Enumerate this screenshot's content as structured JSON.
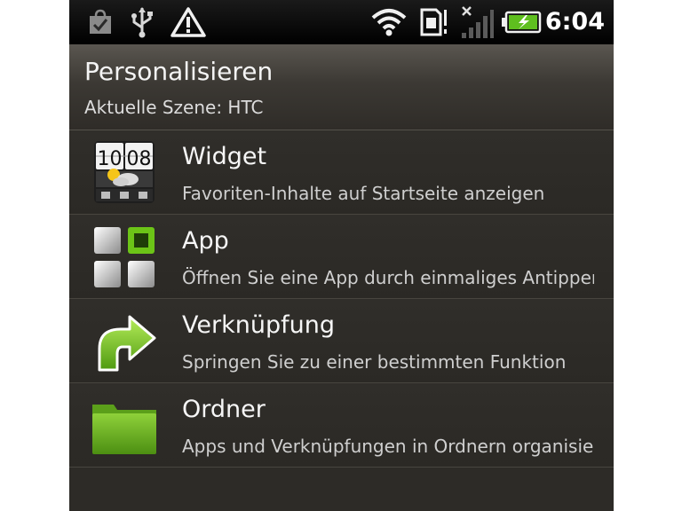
{
  "status_bar": {
    "icons": [
      "check-bag-icon",
      "usb-icon",
      "warning-icon",
      "wifi-icon",
      "sim-card-icon",
      "signal-icon",
      "battery-charging-icon"
    ],
    "time": "6:04"
  },
  "header": {
    "title": "Personalisieren",
    "subtitle": "Aktuelle Szene: HTC"
  },
  "menu": {
    "items": [
      {
        "icon": "widget-icon",
        "title": "Widget",
        "description": "Favoriten-Inhalte auf Startseite anzeigen"
      },
      {
        "icon": "app-grid-icon",
        "title": "App",
        "description": "Öffnen Sie eine App durch einmaliges Antippen"
      },
      {
        "icon": "shortcut-arrow-icon",
        "title": "Verknüpfung",
        "description": "Springen Sie zu einer bestimmten Funktion"
      },
      {
        "icon": "folder-icon",
        "title": "Ordner",
        "description": "Apps und Verknüpfungen in Ordnern organisieren"
      }
    ]
  },
  "widget_icon": {
    "clock_hours": "10",
    "clock_minutes": "08"
  },
  "colors": {
    "background": "#2d2b27",
    "status_bar": "#000000",
    "accent_green": "#6cc417",
    "text_primary": "#f6f6f6",
    "text_secondary": "#cfcfcf"
  }
}
